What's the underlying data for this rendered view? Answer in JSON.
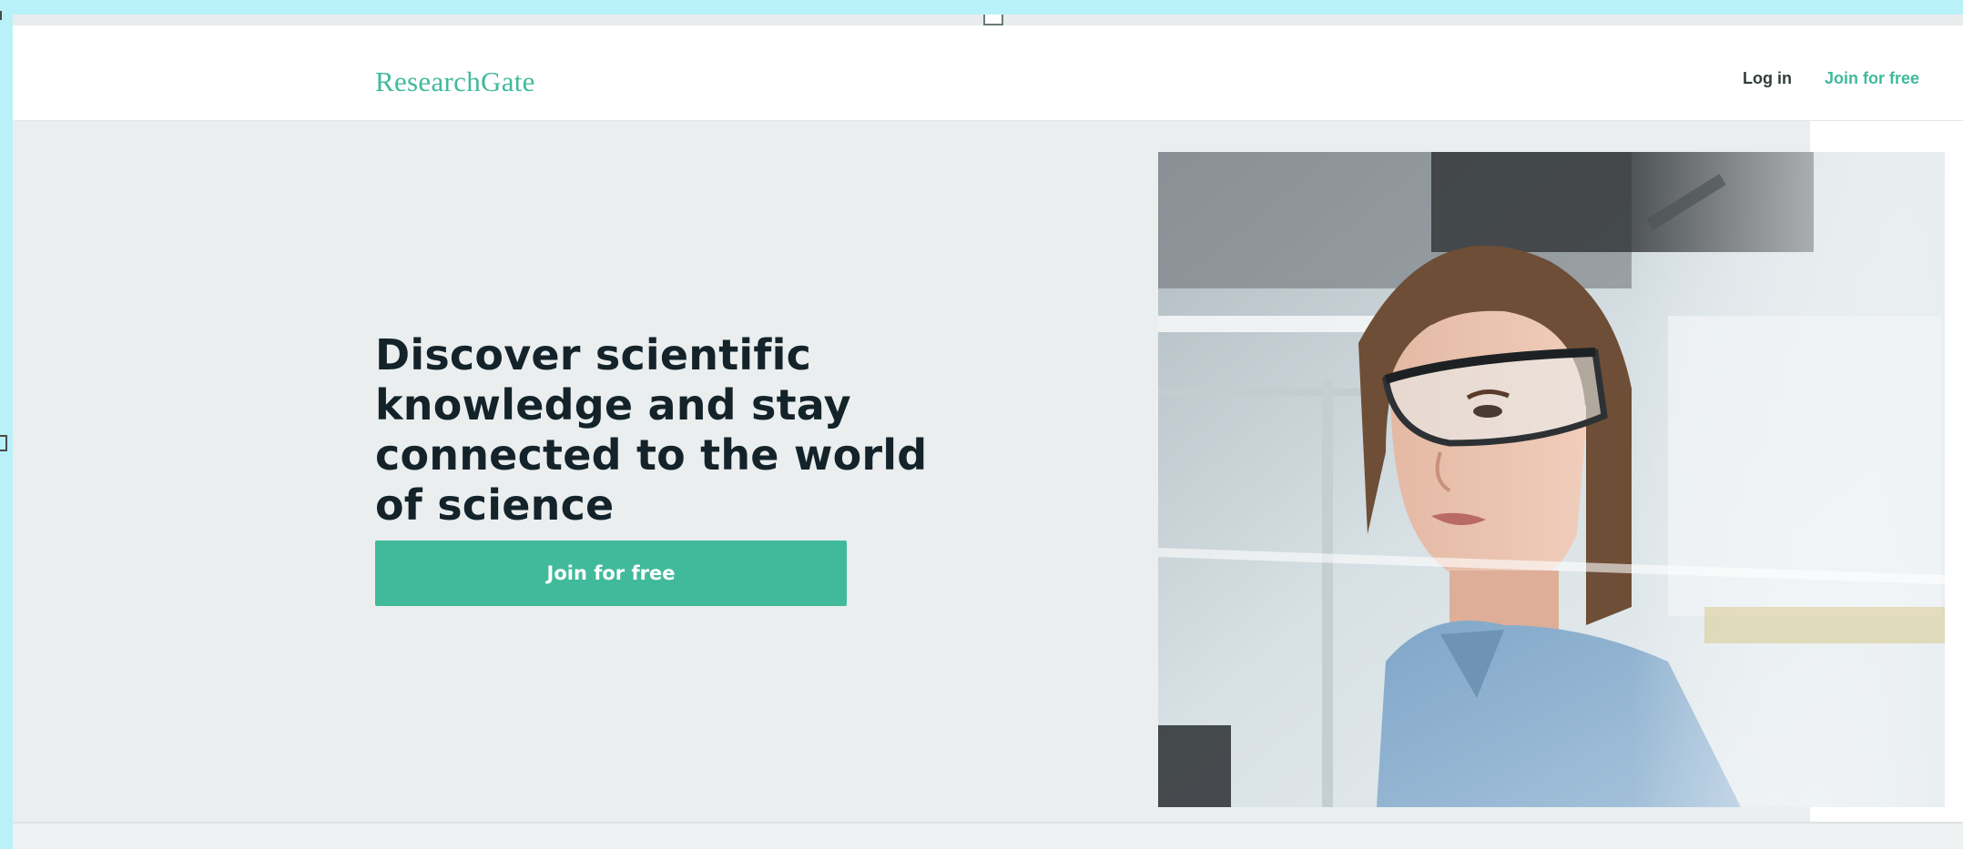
{
  "header": {
    "logo": "ResearchGate",
    "login_label": "Log in",
    "join_label": "Join for free"
  },
  "hero": {
    "headline": "Discover scientific knowledge and stay connected to the world of science",
    "cta_label": "Join for free",
    "image_description": "scientist-with-safety-glasses-photo"
  },
  "colors": {
    "brand": "#40ba9b",
    "hero_bg": "#eaeeee",
    "headline": "#14232a",
    "page_border": "#b8f2f8"
  }
}
